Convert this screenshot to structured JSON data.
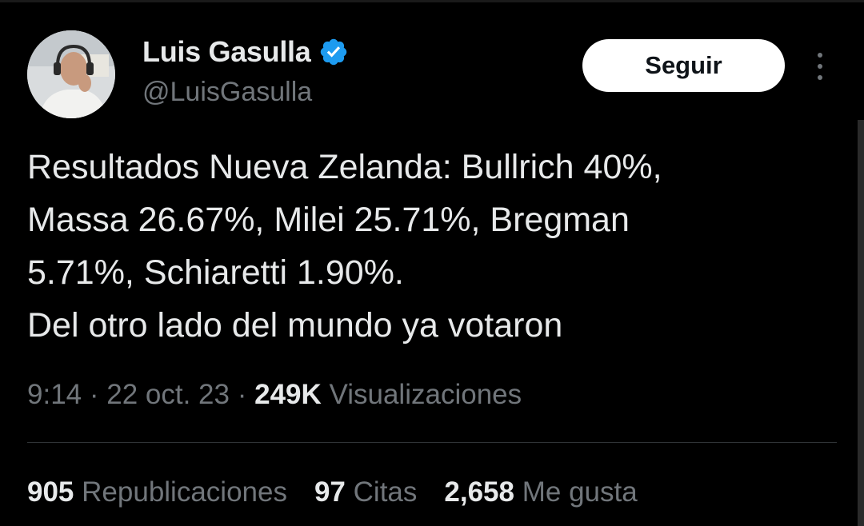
{
  "author": {
    "name": "Luis Gasulla",
    "handle": "@LuisGasulla",
    "verified": true,
    "avatar_icon": "profile-photo"
  },
  "follow_button": {
    "label": "Seguir"
  },
  "more_menu": {
    "icon": "more-vertical-icon"
  },
  "tweet": {
    "text": "Resultados Nueva Zelanda: Bullrich 40%,\nMassa 26.67%, Milei 25.71%, Bregman\n5.71%, Schiaretti 1.90%.\nDel otro lado del mundo ya votaron"
  },
  "meta": {
    "time": "9:14",
    "separator": "·",
    "date": "22 oct. 23",
    "views_count": "249K",
    "views_label": "Visualizaciones"
  },
  "stats": {
    "reposts": {
      "count": "905",
      "label": "Republicaciones"
    },
    "quotes": {
      "count": "97",
      "label": "Citas"
    },
    "likes": {
      "count": "2,658",
      "label": "Me gusta"
    }
  },
  "colors": {
    "background": "#000000",
    "primary_text": "#e7e9ea",
    "secondary_text": "#71767b",
    "verified_badge": "#1d9bf0",
    "button_bg": "#ffffff",
    "divider": "#2f3336"
  }
}
